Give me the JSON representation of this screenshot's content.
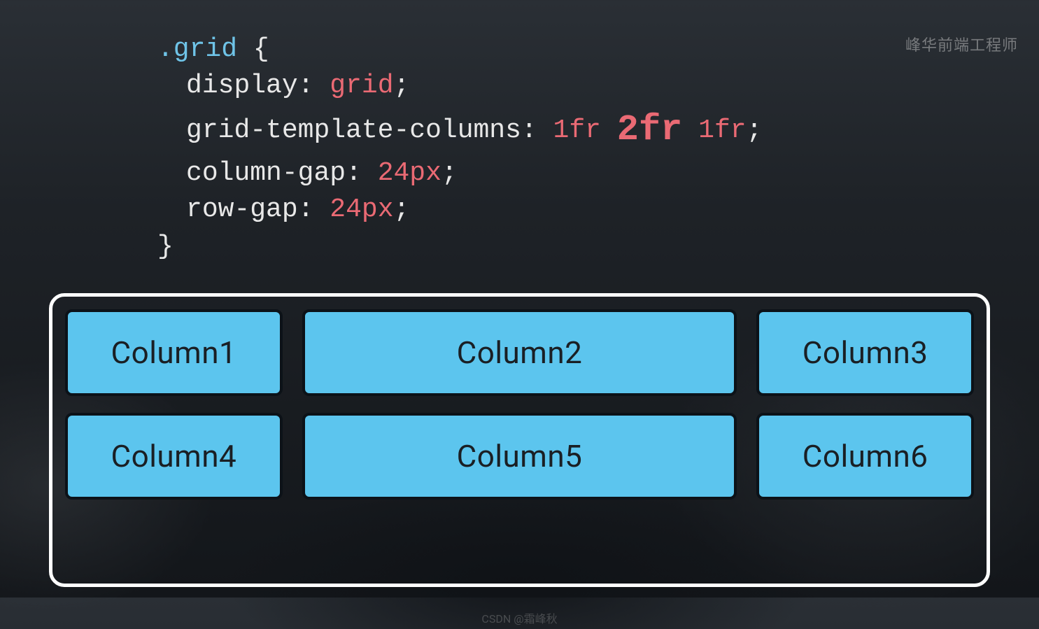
{
  "watermark_top": "峰华前端工程师",
  "watermark_bottom": "CSDN @霜峰秋",
  "code": {
    "selector": ".grid",
    "brace_open": " {",
    "brace_close": "}",
    "lines": [
      {
        "prop": "display",
        "colon": ": ",
        "value": "grid",
        "semi": ";"
      },
      {
        "prop": "grid-template-columns",
        "colon": ": ",
        "value_parts": [
          "1fr ",
          "2fr",
          " 1fr"
        ],
        "semi": ";"
      },
      {
        "prop": "column-gap",
        "colon": ": ",
        "value": "24px",
        "semi": ";"
      },
      {
        "prop": "row-gap",
        "colon": ": ",
        "value": "24px",
        "semi": ";"
      }
    ]
  },
  "grid": {
    "cells": [
      "Column1",
      "Column2",
      "Column3",
      "Column4",
      "Column5",
      "Column6"
    ]
  }
}
